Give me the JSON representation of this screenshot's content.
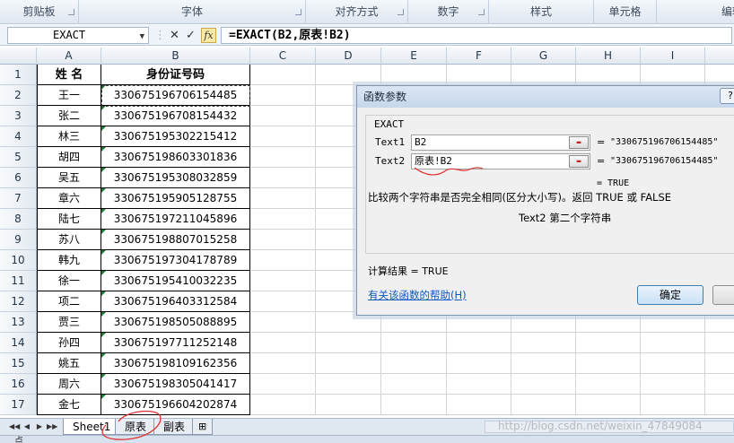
{
  "ribbon": {
    "groups": [
      "剪贴板",
      "字体",
      "对齐方式",
      "数字",
      "样式",
      "单元格",
      "编辑"
    ]
  },
  "formula_bar": {
    "name_box": "EXACT",
    "cancel_icon": "✕",
    "enter_icon": "✓",
    "fx_label": "fx",
    "formula": "=EXACT(B2,原表!B2)"
  },
  "grid": {
    "columns": [
      "A",
      "B",
      "C",
      "D",
      "E",
      "F",
      "G",
      "H",
      "I",
      "J"
    ],
    "rows": [
      "1",
      "2",
      "3",
      "4",
      "5",
      "6",
      "7",
      "8",
      "9",
      "10",
      "11",
      "12",
      "13",
      "14",
      "15",
      "16",
      "17"
    ],
    "header_row": {
      "name": "姓 名",
      "id": "身份证号码"
    },
    "records": [
      {
        "name": "王一",
        "id": "330675196706154485"
      },
      {
        "name": "张二",
        "id": "330675196708154432"
      },
      {
        "name": "林三",
        "id": "330675195302215412"
      },
      {
        "name": "胡四",
        "id": "330675198603301836"
      },
      {
        "name": "吴五",
        "id": "330675195308032859"
      },
      {
        "name": "章六",
        "id": "330675195905128755"
      },
      {
        "name": "陆七",
        "id": "330675197211045896"
      },
      {
        "name": "苏八",
        "id": "330675198807015258"
      },
      {
        "name": "韩九",
        "id": "330675197304178789"
      },
      {
        "name": "徐一",
        "id": "330675195410032235"
      },
      {
        "name": "项二",
        "id": "330675196403312584"
      },
      {
        "name": "贾三",
        "id": "330675198505088895"
      },
      {
        "name": "孙四",
        "id": "330675197711252148"
      },
      {
        "name": "姚五",
        "id": "330675198109162356"
      },
      {
        "name": "周六",
        "id": "330675198305041417"
      },
      {
        "name": "金七",
        "id": "330675196604202874"
      }
    ]
  },
  "dialog": {
    "title": "函数参数",
    "help_q": "?",
    "function_name": "EXACT",
    "args": [
      {
        "label": "Text1",
        "value": "B2",
        "result": "\"330675196706154485\""
      },
      {
        "label": "Text2",
        "value": "原表!B2",
        "result": "\"330675196706154485\""
      }
    ],
    "eq": "=",
    "inline_result": "= TRUE",
    "description": "比较两个字符串是否完全相同(区分大小写)。返回 TRUE 或 FALSE",
    "arg_description": "Text2  第二个字符串",
    "calc_result": "计算结果 =  TRUE",
    "help_link": "有关该函数的帮助(H)",
    "ok": "确定"
  },
  "sheets": {
    "tabs": [
      "Sheet1",
      "原表",
      "副表"
    ],
    "active": "Sheet1",
    "watermark": "http://blog.csdn.net/weixin_47849084"
  },
  "status": {
    "text": "点"
  },
  "colors": {
    "triangle": "#1f7a2e",
    "link": "#0b57c1",
    "annotation": "#e03030"
  }
}
